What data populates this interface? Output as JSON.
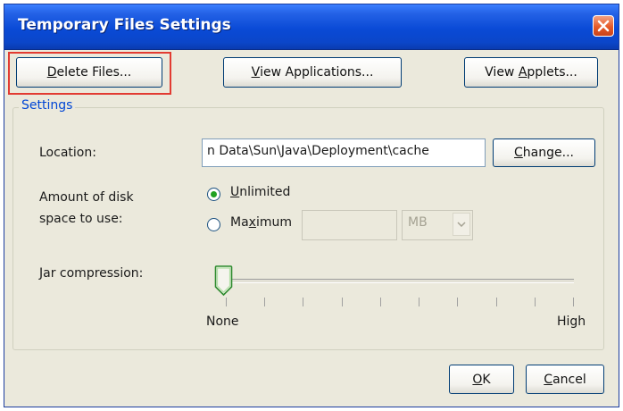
{
  "window": {
    "title": "Temporary Files Settings"
  },
  "top_buttons": {
    "delete_files": {
      "prefix": "",
      "mnemonic": "D",
      "suffix": "elete Files..."
    },
    "view_applications": {
      "prefix": "",
      "mnemonic": "V",
      "suffix": "iew Applications..."
    },
    "view_applets": {
      "prefix": "View ",
      "mnemonic": "A",
      "suffix": "pplets..."
    }
  },
  "settings": {
    "group_label": "Settings",
    "location_label": "Location:",
    "location_value": "n Data\\Sun\\Java\\Deployment\\cache",
    "change_button": {
      "prefix": "",
      "mnemonic": "C",
      "suffix": "hange..."
    },
    "disk_label_line1": "Amount of disk",
    "disk_label_line2": "space to use:",
    "unlimited": {
      "prefix": "",
      "mnemonic": "U",
      "suffix": "nlimited",
      "selected": true
    },
    "maximum": {
      "prefix": "Ma",
      "mnemonic": "x",
      "suffix": "imum",
      "selected": false
    },
    "maximum_value": "",
    "unit_selected": "MB",
    "jar_label": "Jar compression:",
    "slider_min_label": "None",
    "slider_max_label": "High",
    "slider_value": 0
  },
  "bottom_buttons": {
    "ok": {
      "prefix": "",
      "mnemonic": "O",
      "suffix": "K"
    },
    "cancel": {
      "prefix": "",
      "mnemonic": "C",
      "suffix": "ancel"
    }
  },
  "colors": {
    "title_bar": "#0a4ad6",
    "group_label": "#0046d5",
    "highlight_box": "#e23b32",
    "radio_dot": "#21a121"
  }
}
